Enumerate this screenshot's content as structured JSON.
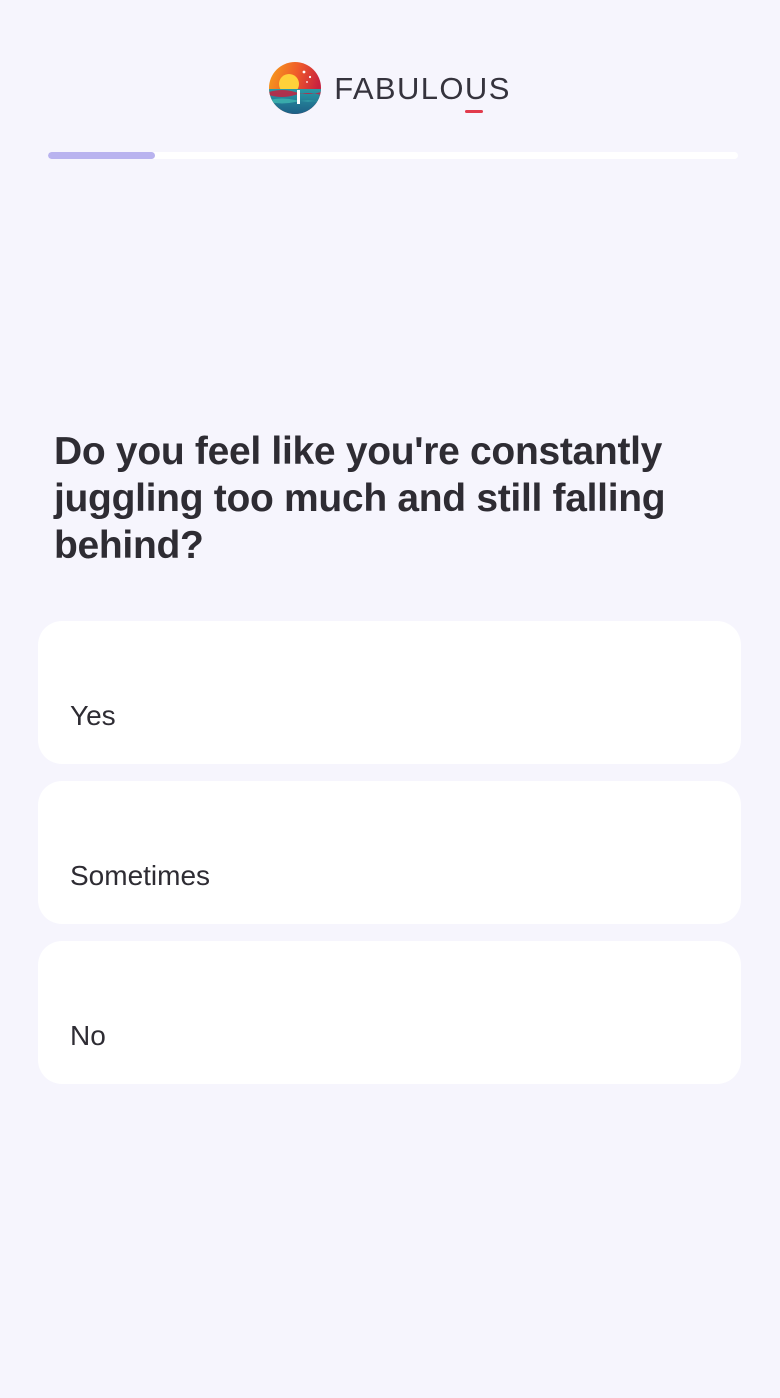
{
  "header": {
    "brand": "FABULOUS",
    "logo_icon": "fabulous-sunset-logo-icon"
  },
  "progress": {
    "value": 0.155
  },
  "question": {
    "text": "Do you feel like you're constantly juggling too much and still falling behind?"
  },
  "options": [
    {
      "label": "Yes"
    },
    {
      "label": "Sometimes"
    },
    {
      "label": "No"
    }
  ],
  "colors": {
    "background": "#f6f5fd",
    "card": "#ffffff",
    "text": "#2e2c33",
    "progress_fill": "#b9b3ef",
    "progress_track": "#ffffff",
    "brand_accent": "#e23b4c"
  }
}
